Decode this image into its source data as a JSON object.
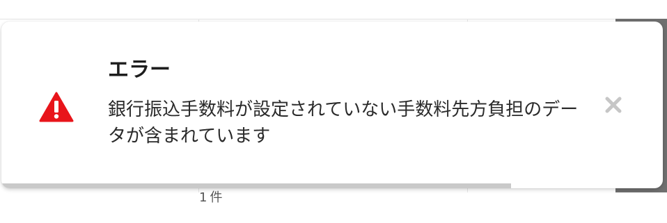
{
  "toast": {
    "title": "エラー",
    "message": "銀行振込手数料が設定されていない手数料先方負担のデータが含まれています",
    "icon": "warning-triangle-icon",
    "close_icon": "close-icon",
    "accent_color": "#e8151b",
    "close_color": "#c6c6c6",
    "progress_remaining": 0.77
  },
  "background": {
    "peek_text": "1件"
  }
}
